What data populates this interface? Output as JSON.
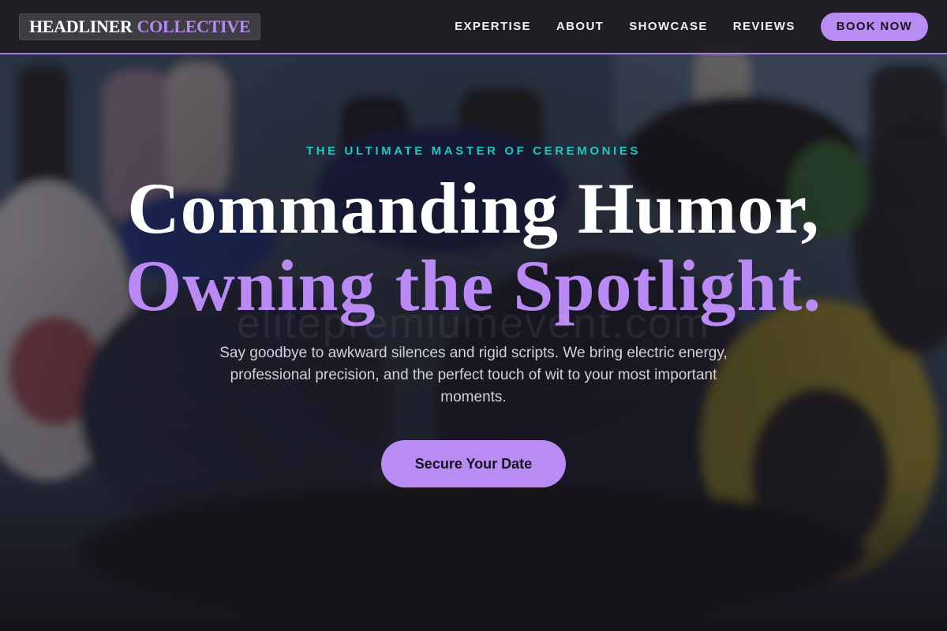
{
  "header": {
    "logo_word1": "HEADLINER",
    "logo_word2": "COLLECTIVE",
    "nav": [
      {
        "label": "EXPERTISE"
      },
      {
        "label": "ABOUT"
      },
      {
        "label": "SHOWCASE"
      },
      {
        "label": "REVIEWS"
      }
    ],
    "book_label": "BOOK NOW"
  },
  "hero": {
    "eyebrow": "THE ULTIMATE MASTER OF CEREMONIES",
    "headline_line1": "Commanding Humor,",
    "headline_line2": "Owning the Spotlight.",
    "watermark": "elitepremiumevent.com",
    "subtext": "Say goodbye to awkward silences and rigid scripts. We bring electric energy, professional precision, and the perfect touch of wit to your most important moments.",
    "cta_label": "Secure Your Date"
  },
  "colors": {
    "accent": "#b98af3",
    "eyebrow": "#22c7c0",
    "header_bg": "#1c1a1e",
    "text_light": "#ffffff"
  },
  "icons": {
    "background_image": "motorcycle-crowd-photo"
  }
}
